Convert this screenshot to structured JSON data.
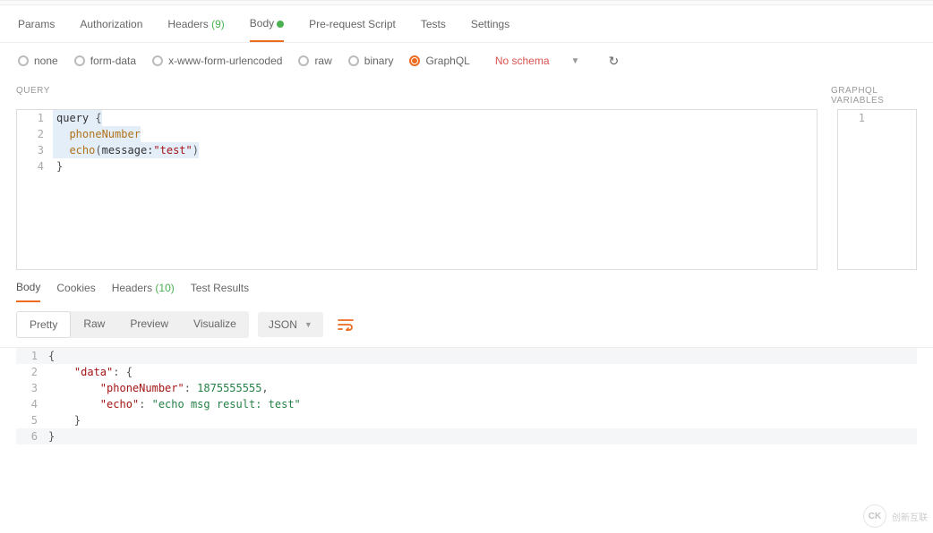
{
  "tabs": {
    "params": "Params",
    "authorization": "Authorization",
    "headers_label": "Headers",
    "headers_count": "(9)",
    "body": "Body",
    "prerequest": "Pre-request Script",
    "tests": "Tests",
    "settings": "Settings"
  },
  "body_types": {
    "none": "none",
    "form_data": "form-data",
    "xwww": "x-www-form-urlencoded",
    "raw": "raw",
    "binary": "binary",
    "graphql": "GraphQL"
  },
  "schema": {
    "label": "No schema"
  },
  "panels": {
    "query": "QUERY",
    "variables": "GRAPHQL VARIABLES"
  },
  "query_lines": {
    "l1_kw": "query",
    "l1_brace": " {",
    "l2_field": "phoneNumber",
    "l3_field": "echo",
    "l3_arg": "message:",
    "l3_str": "\"test\"",
    "l4_brace": "}"
  },
  "query_gutter": {
    "n1": "1",
    "n2": "2",
    "n3": "3",
    "n4": "4"
  },
  "vars_gutter": {
    "n1": "1"
  },
  "response_tabs": {
    "body": "Body",
    "cookies": "Cookies",
    "headers": "Headers",
    "headers_count": "(10)",
    "test_results": "Test Results"
  },
  "format": {
    "pretty": "Pretty",
    "raw": "Raw",
    "preview": "Preview",
    "visualize": "Visualize",
    "json": "JSON"
  },
  "response_lines": {
    "g1": "1",
    "g2": "2",
    "g3": "3",
    "g4": "4",
    "g5": "5",
    "g6": "6",
    "l1": "{",
    "l2_key": "\"data\"",
    "l2_rest": ": {",
    "l3_key": "\"phoneNumber\"",
    "l3_colon": ": ",
    "l3_val": "1875555555",
    "l3_comma": ",",
    "l4_key": "\"echo\"",
    "l4_colon": ": ",
    "l4_val": "\"echo msg result: test\"",
    "l5": "    }",
    "l6": "}"
  },
  "watermark": {
    "logo": "CK",
    "text": "创新互联"
  }
}
